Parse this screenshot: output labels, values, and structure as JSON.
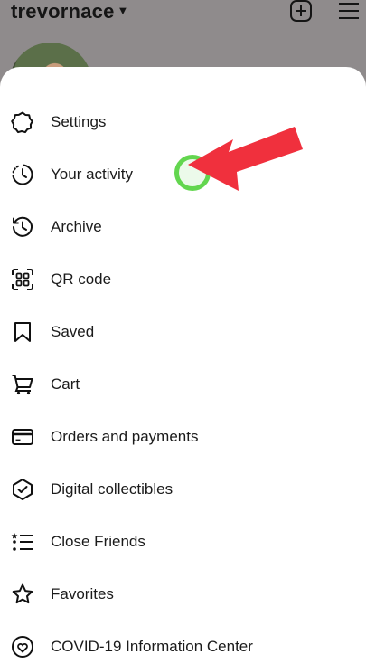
{
  "header": {
    "username": "trevornace",
    "chevron_icon": "chevron-down-icon",
    "new_post_icon": "plus-square-icon",
    "menu_icon": "hamburger-menu-icon"
  },
  "menu": {
    "items": [
      {
        "label": "Settings",
        "icon": "gear-icon"
      },
      {
        "label": "Your activity",
        "icon": "activity-clock-icon"
      },
      {
        "label": "Archive",
        "icon": "archive-history-icon"
      },
      {
        "label": "QR code",
        "icon": "qr-code-icon"
      },
      {
        "label": "Saved",
        "icon": "bookmark-icon"
      },
      {
        "label": "Cart",
        "icon": "cart-icon"
      },
      {
        "label": "Orders and payments",
        "icon": "credit-card-icon"
      },
      {
        "label": "Digital collectibles",
        "icon": "verified-shield-icon"
      },
      {
        "label": "Close Friends",
        "icon": "close-friends-list-icon"
      },
      {
        "label": "Favorites",
        "icon": "star-icon"
      },
      {
        "label": "COVID-19 Information Center",
        "icon": "heart-info-icon"
      }
    ]
  },
  "annotation": {
    "arrow_color": "#f0303d",
    "tap_ring_color": "#63d64f"
  }
}
